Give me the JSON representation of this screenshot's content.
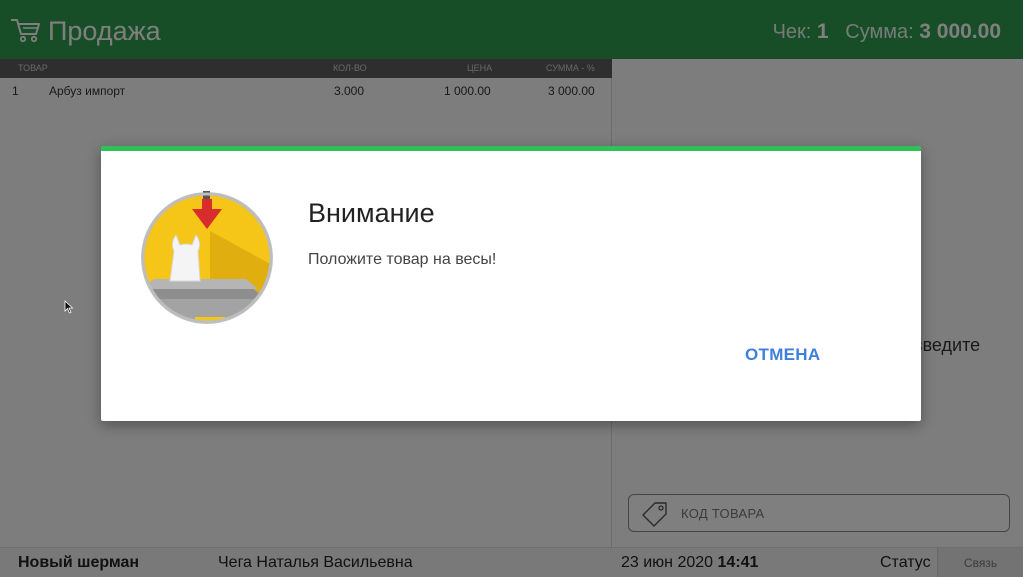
{
  "header": {
    "title": "Продажа",
    "receipt_label": "Чек:",
    "receipt_number": "1",
    "sum_label": "Сумма:",
    "sum_value": "3 000.00"
  },
  "table": {
    "columns": {
      "item": "ТОВАР",
      "qty": "КОЛ-ВО",
      "price": "ЦЕНА",
      "sum": "СУММА - %"
    },
    "rows": [
      {
        "n": "1",
        "item": "Арбуз импорт",
        "qty": "3.000",
        "price": "1 000.00",
        "sum": "3 000.00"
      }
    ]
  },
  "right_panel": {
    "hint_fragment": "введите",
    "code_placeholder": "КОД ТОВАРА"
  },
  "footer": {
    "store": "Новый шерман",
    "cashier": "Чега Наталья Васильевна",
    "date": "23 июн 2020",
    "time": "14:41",
    "status": "Статус",
    "connection": "Связь"
  },
  "dialog": {
    "title": "Внимание",
    "message": "Положите товар на весы!",
    "cancel_label": "ОТМЕНА",
    "icon": "scale-bag-icon"
  },
  "colors": {
    "header_green": "#2e9a4f",
    "dialog_accent": "#2ec15a",
    "link_blue": "#3f7fe0",
    "table_header": "#5d5d5d"
  }
}
